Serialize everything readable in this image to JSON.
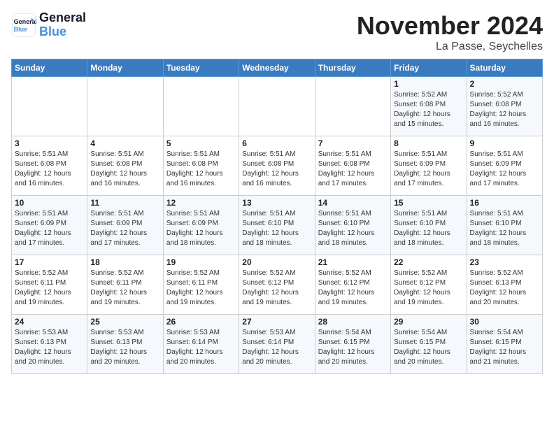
{
  "header": {
    "logo_general": "General",
    "logo_blue": "Blue",
    "month": "November 2024",
    "location": "La Passe, Seychelles"
  },
  "weekdays": [
    "Sunday",
    "Monday",
    "Tuesday",
    "Wednesday",
    "Thursday",
    "Friday",
    "Saturday"
  ],
  "weeks": [
    [
      {
        "day": "",
        "info": ""
      },
      {
        "day": "",
        "info": ""
      },
      {
        "day": "",
        "info": ""
      },
      {
        "day": "",
        "info": ""
      },
      {
        "day": "",
        "info": ""
      },
      {
        "day": "1",
        "info": "Sunrise: 5:52 AM\nSunset: 6:08 PM\nDaylight: 12 hours\nand 15 minutes."
      },
      {
        "day": "2",
        "info": "Sunrise: 5:52 AM\nSunset: 6:08 PM\nDaylight: 12 hours\nand 16 minutes."
      }
    ],
    [
      {
        "day": "3",
        "info": "Sunrise: 5:51 AM\nSunset: 6:08 PM\nDaylight: 12 hours\nand 16 minutes."
      },
      {
        "day": "4",
        "info": "Sunrise: 5:51 AM\nSunset: 6:08 PM\nDaylight: 12 hours\nand 16 minutes."
      },
      {
        "day": "5",
        "info": "Sunrise: 5:51 AM\nSunset: 6:08 PM\nDaylight: 12 hours\nand 16 minutes."
      },
      {
        "day": "6",
        "info": "Sunrise: 5:51 AM\nSunset: 6:08 PM\nDaylight: 12 hours\nand 16 minutes."
      },
      {
        "day": "7",
        "info": "Sunrise: 5:51 AM\nSunset: 6:08 PM\nDaylight: 12 hours\nand 17 minutes."
      },
      {
        "day": "8",
        "info": "Sunrise: 5:51 AM\nSunset: 6:09 PM\nDaylight: 12 hours\nand 17 minutes."
      },
      {
        "day": "9",
        "info": "Sunrise: 5:51 AM\nSunset: 6:09 PM\nDaylight: 12 hours\nand 17 minutes."
      }
    ],
    [
      {
        "day": "10",
        "info": "Sunrise: 5:51 AM\nSunset: 6:09 PM\nDaylight: 12 hours\nand 17 minutes."
      },
      {
        "day": "11",
        "info": "Sunrise: 5:51 AM\nSunset: 6:09 PM\nDaylight: 12 hours\nand 17 minutes."
      },
      {
        "day": "12",
        "info": "Sunrise: 5:51 AM\nSunset: 6:09 PM\nDaylight: 12 hours\nand 18 minutes."
      },
      {
        "day": "13",
        "info": "Sunrise: 5:51 AM\nSunset: 6:10 PM\nDaylight: 12 hours\nand 18 minutes."
      },
      {
        "day": "14",
        "info": "Sunrise: 5:51 AM\nSunset: 6:10 PM\nDaylight: 12 hours\nand 18 minutes."
      },
      {
        "day": "15",
        "info": "Sunrise: 5:51 AM\nSunset: 6:10 PM\nDaylight: 12 hours\nand 18 minutes."
      },
      {
        "day": "16",
        "info": "Sunrise: 5:51 AM\nSunset: 6:10 PM\nDaylight: 12 hours\nand 18 minutes."
      }
    ],
    [
      {
        "day": "17",
        "info": "Sunrise: 5:52 AM\nSunset: 6:11 PM\nDaylight: 12 hours\nand 19 minutes."
      },
      {
        "day": "18",
        "info": "Sunrise: 5:52 AM\nSunset: 6:11 PM\nDaylight: 12 hours\nand 19 minutes."
      },
      {
        "day": "19",
        "info": "Sunrise: 5:52 AM\nSunset: 6:11 PM\nDaylight: 12 hours\nand 19 minutes."
      },
      {
        "day": "20",
        "info": "Sunrise: 5:52 AM\nSunset: 6:12 PM\nDaylight: 12 hours\nand 19 minutes."
      },
      {
        "day": "21",
        "info": "Sunrise: 5:52 AM\nSunset: 6:12 PM\nDaylight: 12 hours\nand 19 minutes."
      },
      {
        "day": "22",
        "info": "Sunrise: 5:52 AM\nSunset: 6:12 PM\nDaylight: 12 hours\nand 19 minutes."
      },
      {
        "day": "23",
        "info": "Sunrise: 5:52 AM\nSunset: 6:13 PM\nDaylight: 12 hours\nand 20 minutes."
      }
    ],
    [
      {
        "day": "24",
        "info": "Sunrise: 5:53 AM\nSunset: 6:13 PM\nDaylight: 12 hours\nand 20 minutes."
      },
      {
        "day": "25",
        "info": "Sunrise: 5:53 AM\nSunset: 6:13 PM\nDaylight: 12 hours\nand 20 minutes."
      },
      {
        "day": "26",
        "info": "Sunrise: 5:53 AM\nSunset: 6:14 PM\nDaylight: 12 hours\nand 20 minutes."
      },
      {
        "day": "27",
        "info": "Sunrise: 5:53 AM\nSunset: 6:14 PM\nDaylight: 12 hours\nand 20 minutes."
      },
      {
        "day": "28",
        "info": "Sunrise: 5:54 AM\nSunset: 6:15 PM\nDaylight: 12 hours\nand 20 minutes."
      },
      {
        "day": "29",
        "info": "Sunrise: 5:54 AM\nSunset: 6:15 PM\nDaylight: 12 hours\nand 20 minutes."
      },
      {
        "day": "30",
        "info": "Sunrise: 5:54 AM\nSunset: 6:15 PM\nDaylight: 12 hours\nand 21 minutes."
      }
    ]
  ]
}
